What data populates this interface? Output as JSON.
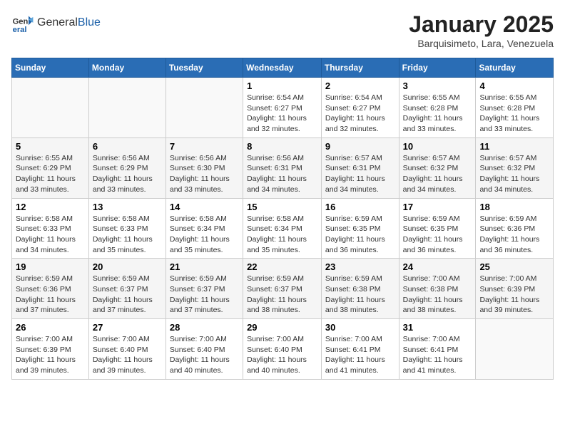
{
  "header": {
    "logo_general": "General",
    "logo_blue": "Blue",
    "title": "January 2025",
    "subtitle": "Barquisimeto, Lara, Venezuela"
  },
  "days_of_week": [
    "Sunday",
    "Monday",
    "Tuesday",
    "Wednesday",
    "Thursday",
    "Friday",
    "Saturday"
  ],
  "weeks": [
    [
      {
        "day": "",
        "info": ""
      },
      {
        "day": "",
        "info": ""
      },
      {
        "day": "",
        "info": ""
      },
      {
        "day": "1",
        "info": "Sunrise: 6:54 AM\nSunset: 6:27 PM\nDaylight: 11 hours\nand 32 minutes."
      },
      {
        "day": "2",
        "info": "Sunrise: 6:54 AM\nSunset: 6:27 PM\nDaylight: 11 hours\nand 32 minutes."
      },
      {
        "day": "3",
        "info": "Sunrise: 6:55 AM\nSunset: 6:28 PM\nDaylight: 11 hours\nand 33 minutes."
      },
      {
        "day": "4",
        "info": "Sunrise: 6:55 AM\nSunset: 6:28 PM\nDaylight: 11 hours\nand 33 minutes."
      }
    ],
    [
      {
        "day": "5",
        "info": "Sunrise: 6:55 AM\nSunset: 6:29 PM\nDaylight: 11 hours\nand 33 minutes."
      },
      {
        "day": "6",
        "info": "Sunrise: 6:56 AM\nSunset: 6:29 PM\nDaylight: 11 hours\nand 33 minutes."
      },
      {
        "day": "7",
        "info": "Sunrise: 6:56 AM\nSunset: 6:30 PM\nDaylight: 11 hours\nand 33 minutes."
      },
      {
        "day": "8",
        "info": "Sunrise: 6:56 AM\nSunset: 6:31 PM\nDaylight: 11 hours\nand 34 minutes."
      },
      {
        "day": "9",
        "info": "Sunrise: 6:57 AM\nSunset: 6:31 PM\nDaylight: 11 hours\nand 34 minutes."
      },
      {
        "day": "10",
        "info": "Sunrise: 6:57 AM\nSunset: 6:32 PM\nDaylight: 11 hours\nand 34 minutes."
      },
      {
        "day": "11",
        "info": "Sunrise: 6:57 AM\nSunset: 6:32 PM\nDaylight: 11 hours\nand 34 minutes."
      }
    ],
    [
      {
        "day": "12",
        "info": "Sunrise: 6:58 AM\nSunset: 6:33 PM\nDaylight: 11 hours\nand 34 minutes."
      },
      {
        "day": "13",
        "info": "Sunrise: 6:58 AM\nSunset: 6:33 PM\nDaylight: 11 hours\nand 35 minutes."
      },
      {
        "day": "14",
        "info": "Sunrise: 6:58 AM\nSunset: 6:34 PM\nDaylight: 11 hours\nand 35 minutes."
      },
      {
        "day": "15",
        "info": "Sunrise: 6:58 AM\nSunset: 6:34 PM\nDaylight: 11 hours\nand 35 minutes."
      },
      {
        "day": "16",
        "info": "Sunrise: 6:59 AM\nSunset: 6:35 PM\nDaylight: 11 hours\nand 36 minutes."
      },
      {
        "day": "17",
        "info": "Sunrise: 6:59 AM\nSunset: 6:35 PM\nDaylight: 11 hours\nand 36 minutes."
      },
      {
        "day": "18",
        "info": "Sunrise: 6:59 AM\nSunset: 6:36 PM\nDaylight: 11 hours\nand 36 minutes."
      }
    ],
    [
      {
        "day": "19",
        "info": "Sunrise: 6:59 AM\nSunset: 6:36 PM\nDaylight: 11 hours\nand 37 minutes."
      },
      {
        "day": "20",
        "info": "Sunrise: 6:59 AM\nSunset: 6:37 PM\nDaylight: 11 hours\nand 37 minutes."
      },
      {
        "day": "21",
        "info": "Sunrise: 6:59 AM\nSunset: 6:37 PM\nDaylight: 11 hours\nand 37 minutes."
      },
      {
        "day": "22",
        "info": "Sunrise: 6:59 AM\nSunset: 6:37 PM\nDaylight: 11 hours\nand 38 minutes."
      },
      {
        "day": "23",
        "info": "Sunrise: 6:59 AM\nSunset: 6:38 PM\nDaylight: 11 hours\nand 38 minutes."
      },
      {
        "day": "24",
        "info": "Sunrise: 7:00 AM\nSunset: 6:38 PM\nDaylight: 11 hours\nand 38 minutes."
      },
      {
        "day": "25",
        "info": "Sunrise: 7:00 AM\nSunset: 6:39 PM\nDaylight: 11 hours\nand 39 minutes."
      }
    ],
    [
      {
        "day": "26",
        "info": "Sunrise: 7:00 AM\nSunset: 6:39 PM\nDaylight: 11 hours\nand 39 minutes."
      },
      {
        "day": "27",
        "info": "Sunrise: 7:00 AM\nSunset: 6:40 PM\nDaylight: 11 hours\nand 39 minutes."
      },
      {
        "day": "28",
        "info": "Sunrise: 7:00 AM\nSunset: 6:40 PM\nDaylight: 11 hours\nand 40 minutes."
      },
      {
        "day": "29",
        "info": "Sunrise: 7:00 AM\nSunset: 6:40 PM\nDaylight: 11 hours\nand 40 minutes."
      },
      {
        "day": "30",
        "info": "Sunrise: 7:00 AM\nSunset: 6:41 PM\nDaylight: 11 hours\nand 41 minutes."
      },
      {
        "day": "31",
        "info": "Sunrise: 7:00 AM\nSunset: 6:41 PM\nDaylight: 11 hours\nand 41 minutes."
      },
      {
        "day": "",
        "info": ""
      }
    ]
  ]
}
